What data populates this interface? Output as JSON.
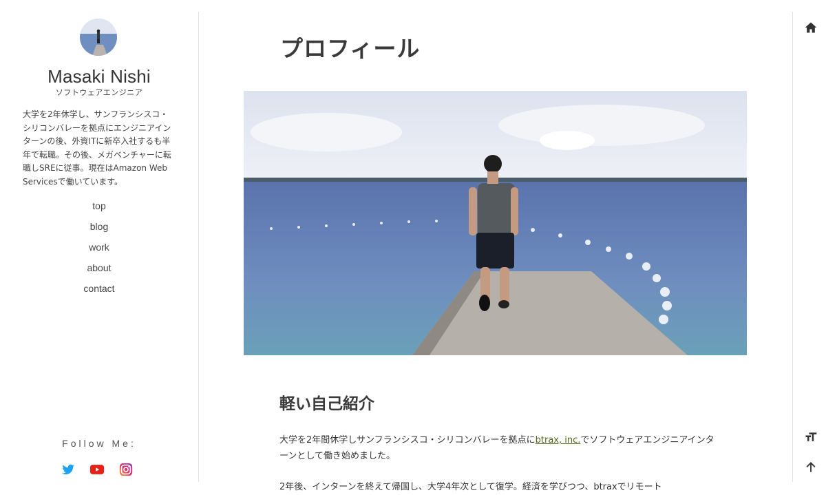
{
  "sidebar": {
    "name": "Masaki Nishi",
    "role": "ソフトウェアエンジニア",
    "bio": "大学を2年休学し、サンフランシスコ・シリコンバレーを拠点にエンジニアインターンの後、外資ITに新卒入社するも半年で転職。その後、メガベンチャーに転職しSREに従事。現在はAmazon Web Servicesで働いています。",
    "nav": [
      "top",
      "blog",
      "work",
      "about",
      "contact"
    ],
    "follow_label": "Follow Me:",
    "social_icons": [
      "twitter-icon",
      "youtube-icon",
      "instagram-icon"
    ]
  },
  "main": {
    "title": "プロフィール",
    "section_heading": "軽い自己紹介",
    "para1_before": "大学を2年間休学しサンフランシスコ・シリコンバレーを拠点に",
    "para1_link": "btrax, inc.",
    "para1_after": "でソフトウェアエンジニアインターンとして働き始めました。",
    "para2": "2年後、インターンを終えて帰国し、大学4年次として復学。経済を学びつつ、btraxでリモート"
  },
  "rail": {
    "icons": [
      "home-icon",
      "font-size-icon",
      "arrow-up-icon"
    ]
  },
  "colors": {
    "link": "#4f6a18",
    "twitter": "#1da1f2",
    "youtube": "#e62117",
    "instagram": "#c13584"
  }
}
